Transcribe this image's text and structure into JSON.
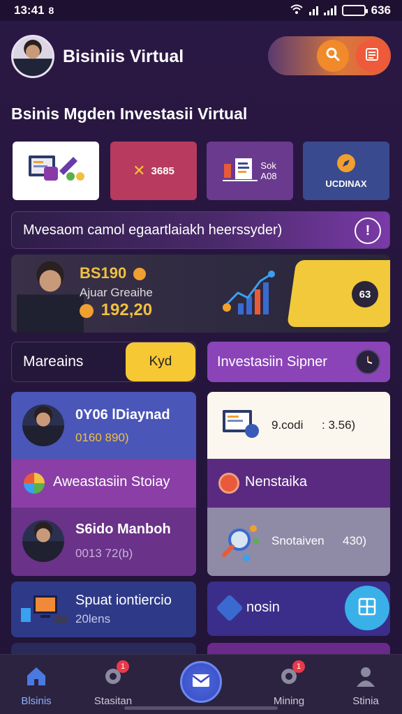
{
  "status_bar": {
    "time": "13:41",
    "time_suffix": "8",
    "battery": "636",
    "battery_level": 0.8
  },
  "header": {
    "title": "Bisiniis Virtual"
  },
  "section_title": "Bsinis Mgden Investasii Virtual",
  "cards": [
    {
      "label": ""
    },
    {
      "label": "3685"
    },
    {
      "line1": "Sok",
      "line2": "A08"
    },
    {
      "label": "UCDINAX"
    }
  ],
  "banner": {
    "text": "Mvesaom camol egaartlaiakh heerssyder)",
    "info_icon": "!"
  },
  "hero": {
    "score": "BS190",
    "subtitle": "Ajuar Greaihe",
    "amount": "192,20",
    "badge": "63"
  },
  "pills": {
    "left_label": "Mareains",
    "left_button": "Kyd",
    "right_label": "Investasiin Sipner"
  },
  "panel_left": {
    "top_name": "0Y06 lDiaynad",
    "top_stat": "0160  890)",
    "mid_label": "Aweastasiin Stoiay",
    "bot_name": "S6ido Manboh",
    "bot_stat": "0013  72(b)"
  },
  "panel_right": {
    "top_text": "9.codi",
    "top_value": ": 3.56)",
    "mid_label": "Nenstaika",
    "bot_text": "Snotaiven",
    "bot_value": "430)"
  },
  "tiles": {
    "left_title": "Spuat iontiercio",
    "left_sub": "20lens",
    "right_label": "nosin"
  },
  "bottom_nav": [
    {
      "label": "Blsinis"
    },
    {
      "label": "Stasitan",
      "badge": "1"
    },
    {
      "label": ""
    },
    {
      "label": "Mining",
      "badge": "1"
    },
    {
      "label": "Stinia"
    }
  ]
}
